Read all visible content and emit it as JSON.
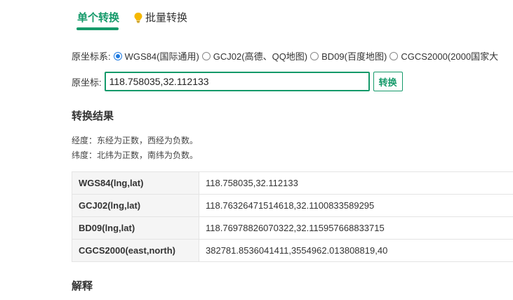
{
  "tabs": {
    "single": "单个转换",
    "batch": "批量转换"
  },
  "source_system": {
    "label": "原坐标系:",
    "options": [
      {
        "label": "WGS84(国际通用)",
        "checked": true
      },
      {
        "label": "GCJ02(高德、QQ地图)",
        "checked": false
      },
      {
        "label": "BD09(百度地图)",
        "checked": false
      },
      {
        "label": "CGCS2000(2000国家大",
        "checked": false
      }
    ]
  },
  "input": {
    "label": "原坐标:",
    "value": "118.758035,32.112133"
  },
  "convert_button": "转换",
  "result": {
    "heading": "转换结果",
    "note_lng": "经度：东经为正数，西经为负数。",
    "note_lat": "纬度：北纬为正数，南纬为负数。",
    "rows": [
      {
        "key": "WGS84(lng,lat)",
        "value": "118.758035,32.112133"
      },
      {
        "key": "GCJ02(lng,lat)",
        "value": "118.76326471514618,32.1100833589295"
      },
      {
        "key": "BD09(lng,lat)",
        "value": "118.76978826070322,32.115957668833715"
      },
      {
        "key": "CGCS2000(east,north)",
        "value": "382781.8536041411,3554962.013808819,40"
      }
    ]
  },
  "explain_heading": "解释",
  "colors": {
    "accent": "#159a6a",
    "radio_checked": "#1f7ae0",
    "bulb": "#f5b800"
  }
}
